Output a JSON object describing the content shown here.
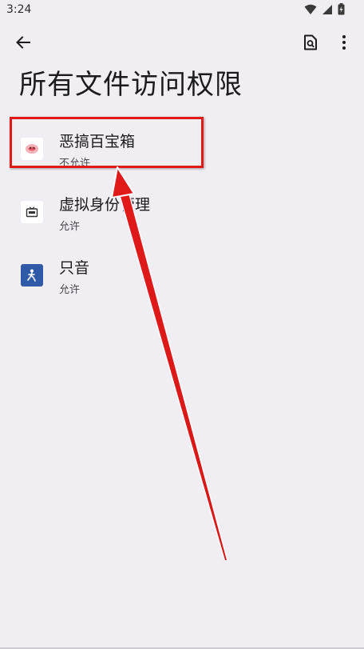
{
  "status_bar": {
    "time": "3:24",
    "icons": [
      "wifi-icon",
      "signal-icon",
      "battery-icon"
    ]
  },
  "toolbar": {
    "back_icon": "back-arrow-icon",
    "search_icon": "doc-search-icon",
    "more_icon": "more-vert-icon"
  },
  "page": {
    "title": "所有文件访问权限"
  },
  "apps": [
    {
      "name": "恶搞百宝箱",
      "status": "不允许",
      "icon": "prank-toolbox-icon"
    },
    {
      "name": "虚拟身份管理",
      "status": "允许",
      "icon": "virtual-identity-icon"
    },
    {
      "name": "只音",
      "status": "允许",
      "icon": "zhiyin-icon"
    }
  ],
  "annotation": {
    "highlight_color": "#e01919",
    "arrow_color": "#e01919"
  },
  "colors": {
    "background": "#f0eef3",
    "text_primary": "#1c1b1f",
    "text_secondary": "#4a4850",
    "zhiyin_icon_bg": "#2f5aa8"
  }
}
